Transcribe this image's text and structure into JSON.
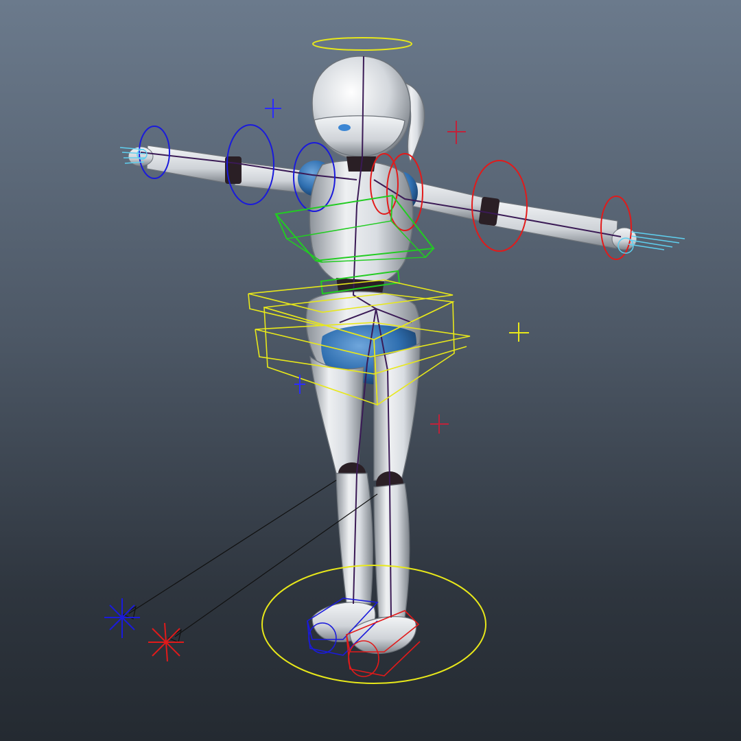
{
  "viewport": {
    "background_top": "#6b7a8c",
    "background_bottom": "#242a31"
  },
  "model": {
    "body_color": "#d9dde2",
    "body_shadow": "#8d939a",
    "accent_color": "#2f6fb0",
    "joint_color": "#2a1f25"
  },
  "controls": {
    "left_side_color": "#1a1adc",
    "right_side_color": "#e21a1a",
    "spine_color": "#22cc22",
    "root_color": "#e8e81a",
    "hand_color": "#5fd0f0",
    "skeleton_color": "#3a1a55",
    "pole_line_color": "#111111"
  },
  "icons": {
    "halo": "halo-control",
    "locator": "cross-locator",
    "pole_vector": "star-pole-vector"
  }
}
